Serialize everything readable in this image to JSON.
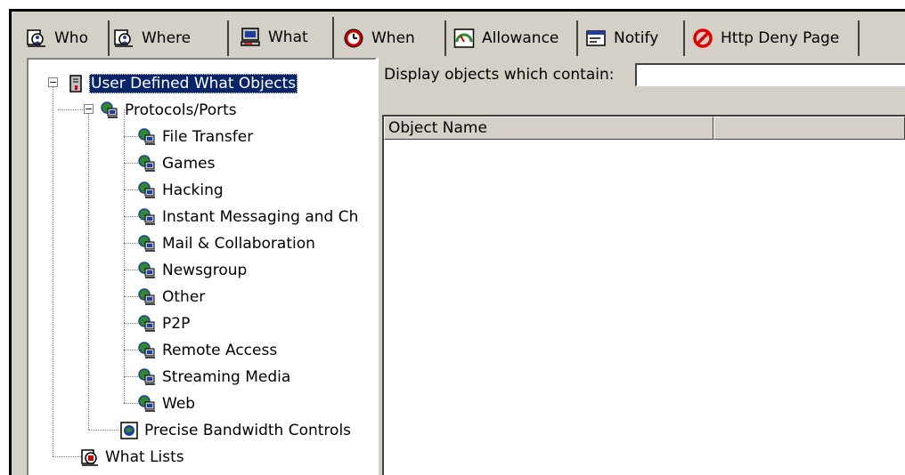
{
  "tabs": [
    {
      "label": "Who",
      "icon": "who-group-icon"
    },
    {
      "label": "Where",
      "icon": "where-group-icon"
    },
    {
      "label": "What",
      "icon": "computer-monitor-icon",
      "active": true
    },
    {
      "label": "When",
      "icon": "clock-icon"
    },
    {
      "label": "Allowance",
      "icon": "gauge-icon"
    },
    {
      "label": "Notify",
      "icon": "message-window-icon"
    },
    {
      "label": "Http Deny Page",
      "icon": "no-entry-icon"
    }
  ],
  "tree": {
    "root_label": "User Defined What Objects",
    "protocols_label": "Protocols/Ports",
    "protocol_children": [
      "File Transfer",
      "Games",
      "Hacking",
      "Instant Messaging and Ch",
      "Mail & Collaboration",
      "Newsgroup",
      "Other",
      "P2P",
      "Remote Access",
      "Streaming Media",
      "Web"
    ],
    "bandwidth_label": "Precise Bandwidth Controls",
    "what_lists_label": "What Lists",
    "expander_symbol": "−"
  },
  "filter": {
    "label": "Display objects which contain:",
    "value": ""
  },
  "list": {
    "columns": [
      "Object Name",
      ""
    ]
  },
  "colors": {
    "face": "#d4d0c8",
    "selection": "#0a246a",
    "icon_red": "#cc0000",
    "icon_blue": "#1f3fa0",
    "icon_green": "#2f8a2f"
  }
}
